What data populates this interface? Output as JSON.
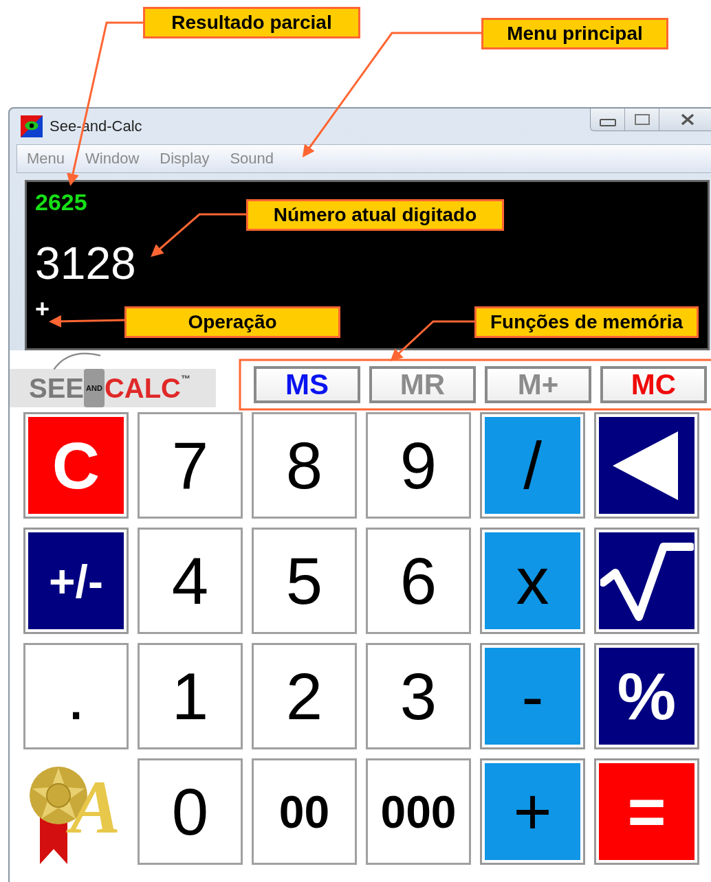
{
  "callouts": [
    {
      "text": "Resultado parcial"
    },
    {
      "text": "Menu principal"
    },
    {
      "text": "Número atual digitado"
    },
    {
      "text": "Operação"
    },
    {
      "text": "Funções de memória"
    }
  ],
  "window": {
    "title": "See-and-Calc"
  },
  "menu": [
    "Menu",
    "Window",
    "Display",
    "Sound"
  ],
  "display": {
    "partial_result": "2625",
    "current_number": "3128",
    "operation": "+"
  },
  "logo": {
    "left": "SEE",
    "middle": "AND",
    "right": "CALC",
    "mark": "™"
  },
  "memory_buttons": [
    {
      "label": "MS",
      "color": "#0a14f0"
    },
    {
      "label": "MR",
      "color": "#8c8c8c"
    },
    {
      "label": "M+",
      "color": "#8c8c8c"
    },
    {
      "label": "MC",
      "color": "#f00a0a"
    }
  ],
  "keys": [
    {
      "kind": "red",
      "label": "C"
    },
    {
      "kind": "white",
      "label": "7"
    },
    {
      "kind": "white",
      "label": "8"
    },
    {
      "kind": "white",
      "label": "9"
    },
    {
      "kind": "blue",
      "label": "/"
    },
    {
      "kind": "back"
    },
    {
      "kind": "navy",
      "label": "+/-"
    },
    {
      "kind": "white",
      "label": "4"
    },
    {
      "kind": "white",
      "label": "5"
    },
    {
      "kind": "white",
      "label": "6"
    },
    {
      "kind": "blue",
      "label": "x"
    },
    {
      "kind": "sqrt"
    },
    {
      "kind": "white",
      "label": "."
    },
    {
      "kind": "white",
      "label": "1"
    },
    {
      "kind": "white",
      "label": "2"
    },
    {
      "kind": "white",
      "label": "3"
    },
    {
      "kind": "blue",
      "label": "-"
    },
    {
      "kind": "navy",
      "label": "%"
    },
    {
      "kind": "award",
      "label": "A"
    },
    {
      "kind": "white",
      "label": "0"
    },
    {
      "kind": "white",
      "label": "00"
    },
    {
      "kind": "white",
      "label": "000"
    },
    {
      "kind": "blue",
      "label": "+"
    },
    {
      "kind": "red",
      "label": "="
    }
  ]
}
